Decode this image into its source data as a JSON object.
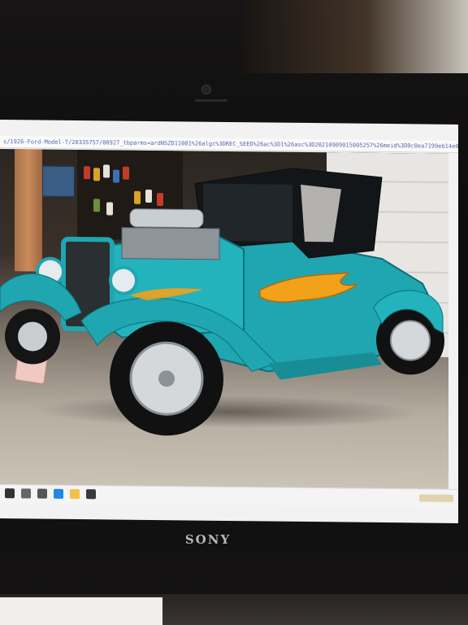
{
  "monitor": {
    "brand_label": "SONY"
  },
  "browser": {
    "address_bar_url": "s/1926-Ford-Model-T/20335757/00927_tbparms=ardNSZD11001%26algc%3DREC_SEED%26ac%3D1%26asc%3D20210909015005257%26meid%3D0c0ea7199eb14e07d9fcf7cb5fce0cce4%26pid%3D1007%26rk%3D1%26rkt%3D"
  },
  "photo": {
    "subject": "teal hot rod with flame graphics",
    "accent_color": "#1fa6b0",
    "flame_color": "#f2a11a"
  },
  "taskbar": {
    "items": [
      "start-icon",
      "search-icon",
      "task-view-icon",
      "edge-icon",
      "file-explorer-icon",
      "store-icon"
    ]
  }
}
